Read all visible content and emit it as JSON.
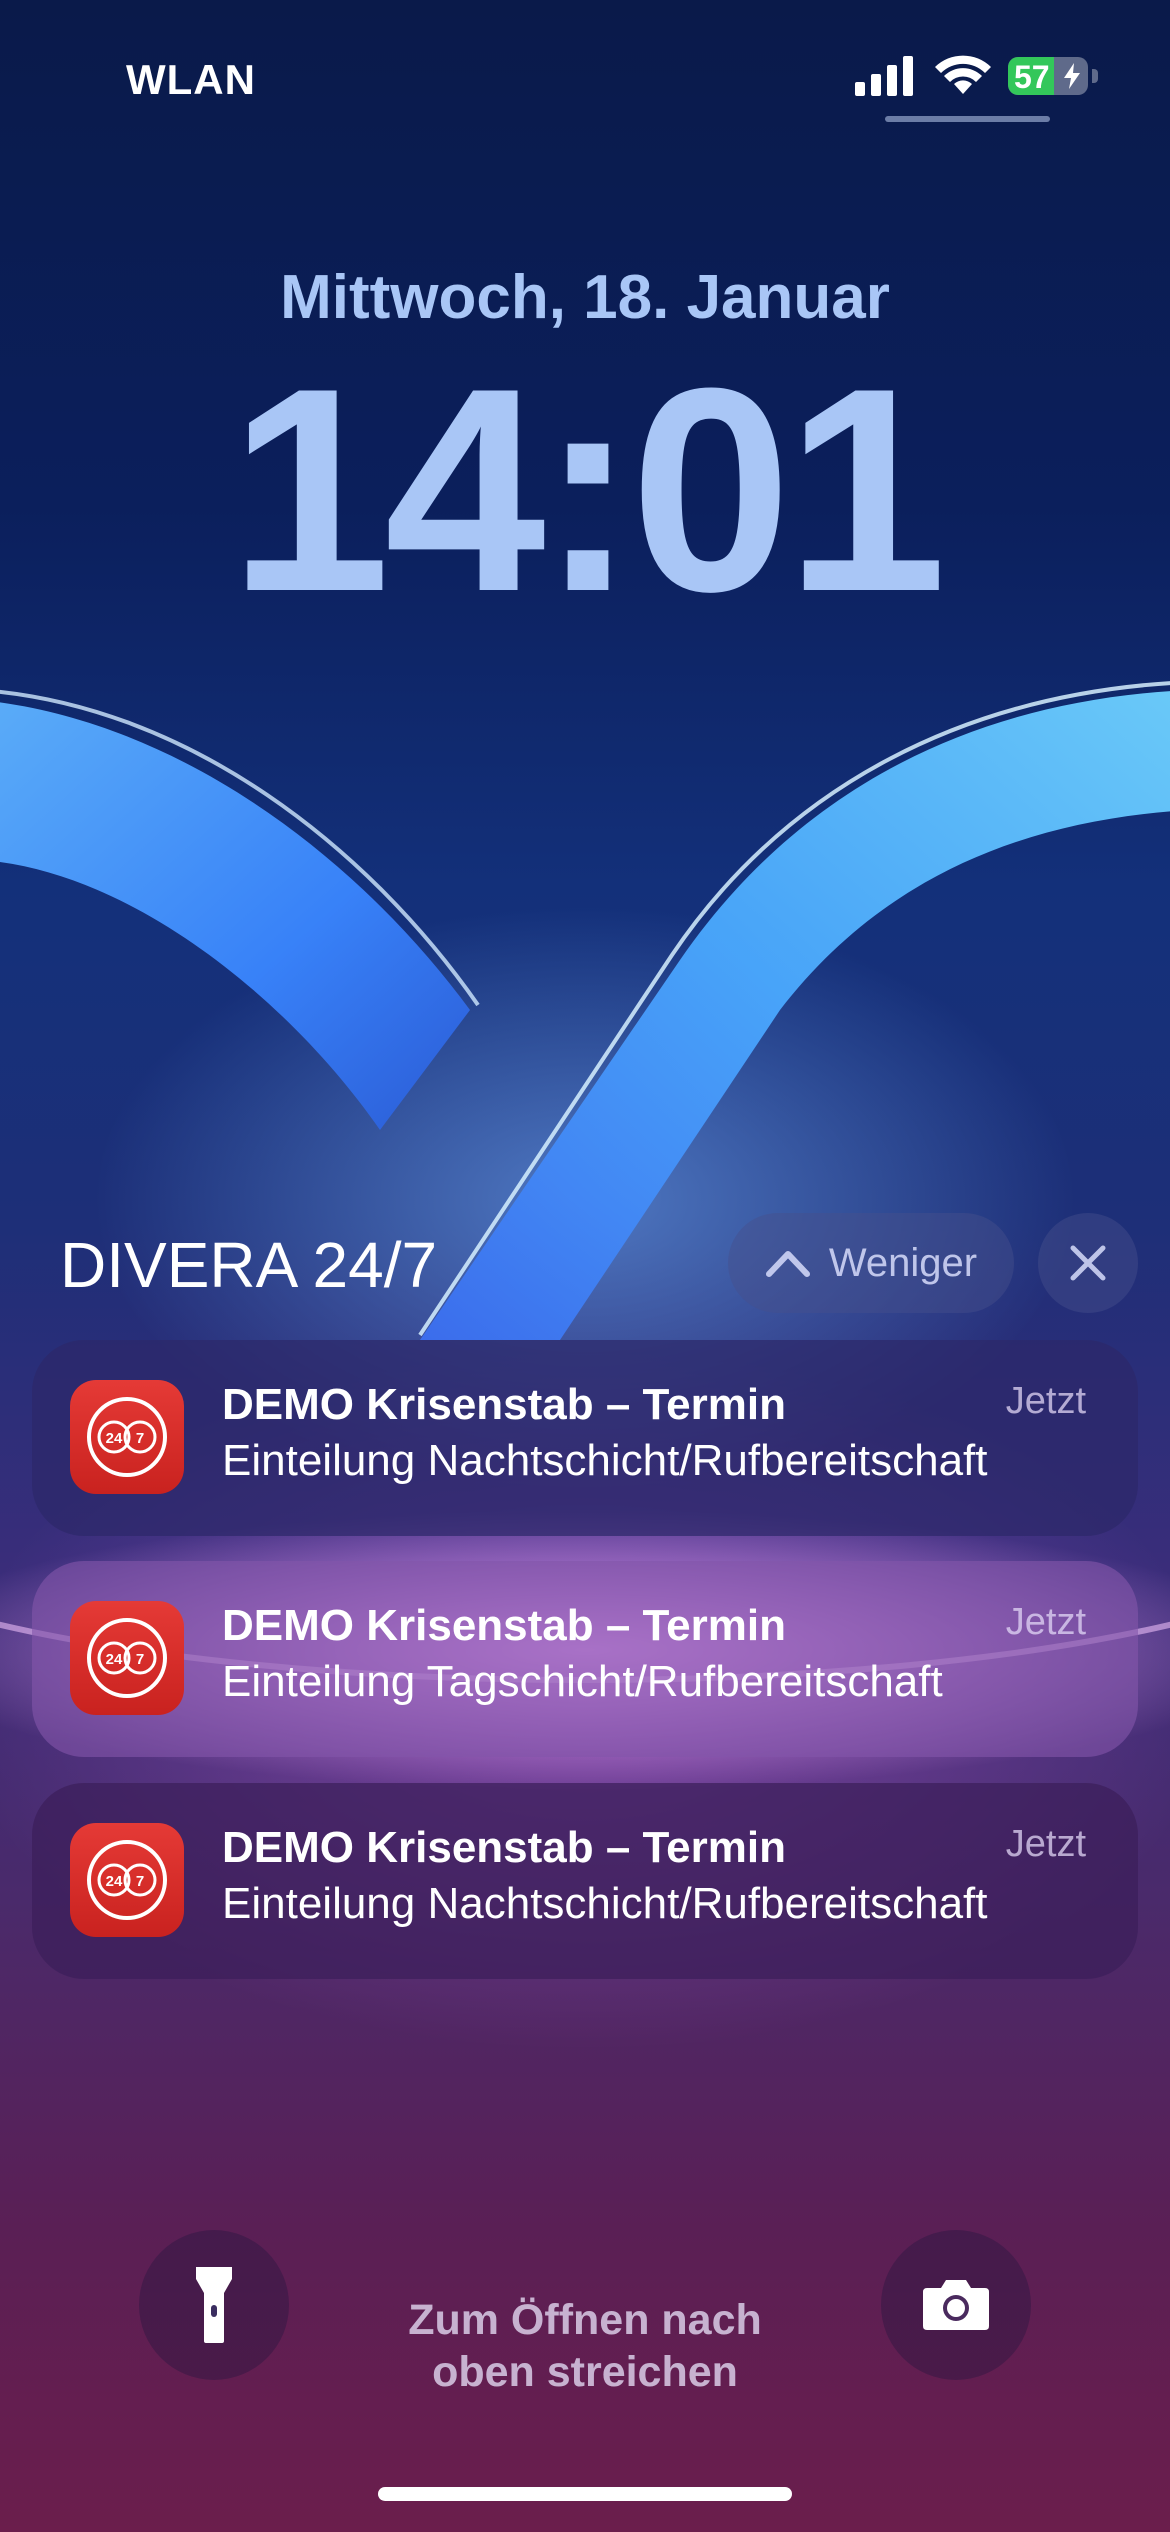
{
  "status_bar": {
    "carrier": "WLAN",
    "battery_level": "57",
    "battery_fraction": 0.57,
    "battery_charging": true,
    "signal_icon": "cellular-signal-icon",
    "wifi_icon": "wifi-icon"
  },
  "lock": {
    "date": "Mittwoch, 18. Januar",
    "time": "14:01"
  },
  "group": {
    "app_name": "DIVERA 24/7",
    "show_less_label": "Weniger",
    "close_icon": "close-icon"
  },
  "notifications": [
    {
      "title": "DEMO Krisenstab – Termin",
      "body": "Einteilung Nachtschicht/Rufbereitschaft",
      "time": "Jetzt",
      "icon_text_left": "24",
      "icon_text_right": "7"
    },
    {
      "title": "DEMO Krisenstab – Termin",
      "body": "Einteilung Tagschicht/Rufbereitschaft",
      "time": "Jetzt",
      "icon_text_left": "24",
      "icon_text_right": "7"
    },
    {
      "title": "DEMO Krisenstab – Termin",
      "body": "Einteilung Nachtschicht/Rufbereitschaft",
      "time": "Jetzt",
      "icon_text_left": "24",
      "icon_text_right": "7"
    }
  ],
  "bottom": {
    "unlock_hint_line1": "Zum Öffnen nach",
    "unlock_hint_line2": "oben streichen",
    "flashlight_icon": "flashlight-icon",
    "camera_icon": "camera-icon"
  },
  "colors": {
    "clock": "#a9c6f6",
    "app_icon": "#d8302c",
    "battery_fill": "#33c75a"
  }
}
